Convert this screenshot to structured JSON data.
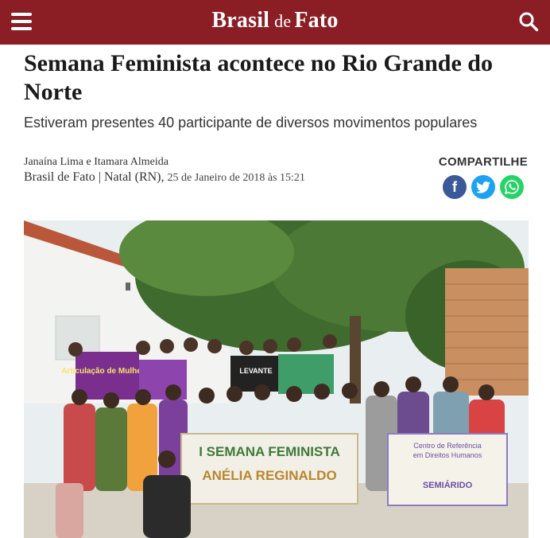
{
  "header": {
    "logo_brasil": "Brasil",
    "logo_de": "de",
    "logo_fato": "Fato"
  },
  "article": {
    "title": "Semana Feminista acontece no Rio Grande do Norte",
    "subtitle": "Estiveram presentes 40 participante de diversos movimentos populares",
    "authors": "Janaína Lima e Itamara Almeida",
    "source": "Brasil de Fato | Natal (RN),",
    "date": "25 de Janeiro de 2018 às 15:21"
  },
  "share": {
    "label": "COMPARTILHE",
    "facebook_glyph": "f"
  },
  "photo": {
    "banner_line1": "I SEMANA FEMINISTA",
    "banner_line2": "ANÉLIA REGINALDO",
    "purple_banner": "Articulação de Mulheres",
    "center_banner_line1": "Centro de Referência",
    "center_banner_line2": "em Direitos Humanos",
    "center_banner_line3": "SEMIÁRIDO",
    "black_banner": "LEVANTE"
  },
  "colors": {
    "brand": "#8b1d24",
    "facebook": "#3b5998",
    "twitter": "#1da1f2",
    "whatsapp": "#25d366"
  },
  "icons": {
    "menu": "hamburger-icon",
    "search": "search-icon",
    "facebook": "facebook-icon",
    "twitter": "twitter-icon",
    "whatsapp": "whatsapp-icon"
  }
}
